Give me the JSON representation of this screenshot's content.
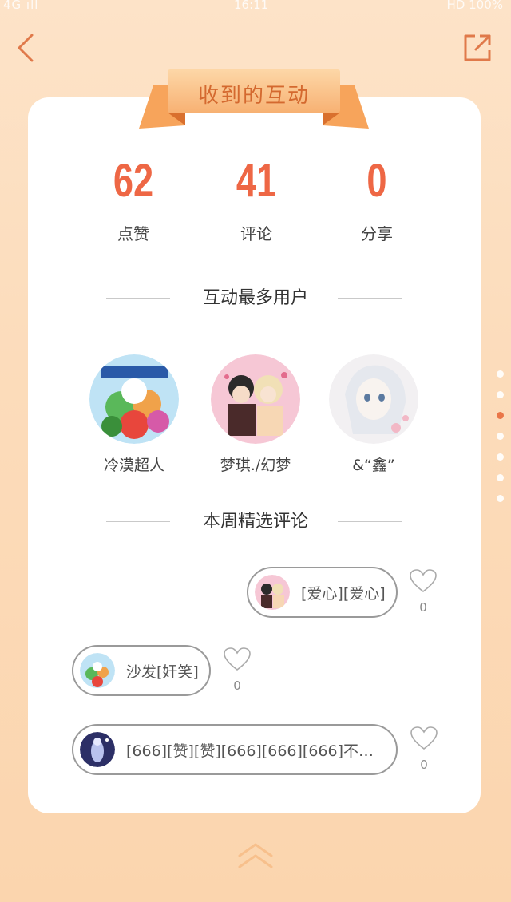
{
  "status_bar": {
    "left": "4G ıll",
    "time": "16:11",
    "right": "HD 100%"
  },
  "header": {
    "title": "收到的互动"
  },
  "stats": [
    {
      "value": "62",
      "label": "点赞"
    },
    {
      "value": "41",
      "label": "评论"
    },
    {
      "value": "0",
      "label": "分享"
    }
  ],
  "top_users": {
    "heading": "互动最多用户",
    "users": [
      {
        "name": "冷漠超人"
      },
      {
        "name": "梦琪./幻梦"
      },
      {
        "name": "&“鑫”"
      }
    ]
  },
  "comments": {
    "heading": "本周精选评论",
    "items": [
      {
        "text": "[爱心][爱心]",
        "likes": "0"
      },
      {
        "text": "沙发[奸笑]",
        "likes": "0"
      },
      {
        "text": "[666][赞][赞][666][666][666]不…",
        "likes": "0"
      }
    ]
  },
  "colors": {
    "accent": "#ee6745",
    "ribbon": "#f5a45e",
    "background": "#fde3c8"
  },
  "icons": {
    "back": "chevron-left-icon",
    "share": "share-out-icon",
    "like": "heart-outline-icon",
    "scroll_up": "double-chevron-up-icon"
  },
  "pagination": {
    "total": 7,
    "active_index": 2
  }
}
